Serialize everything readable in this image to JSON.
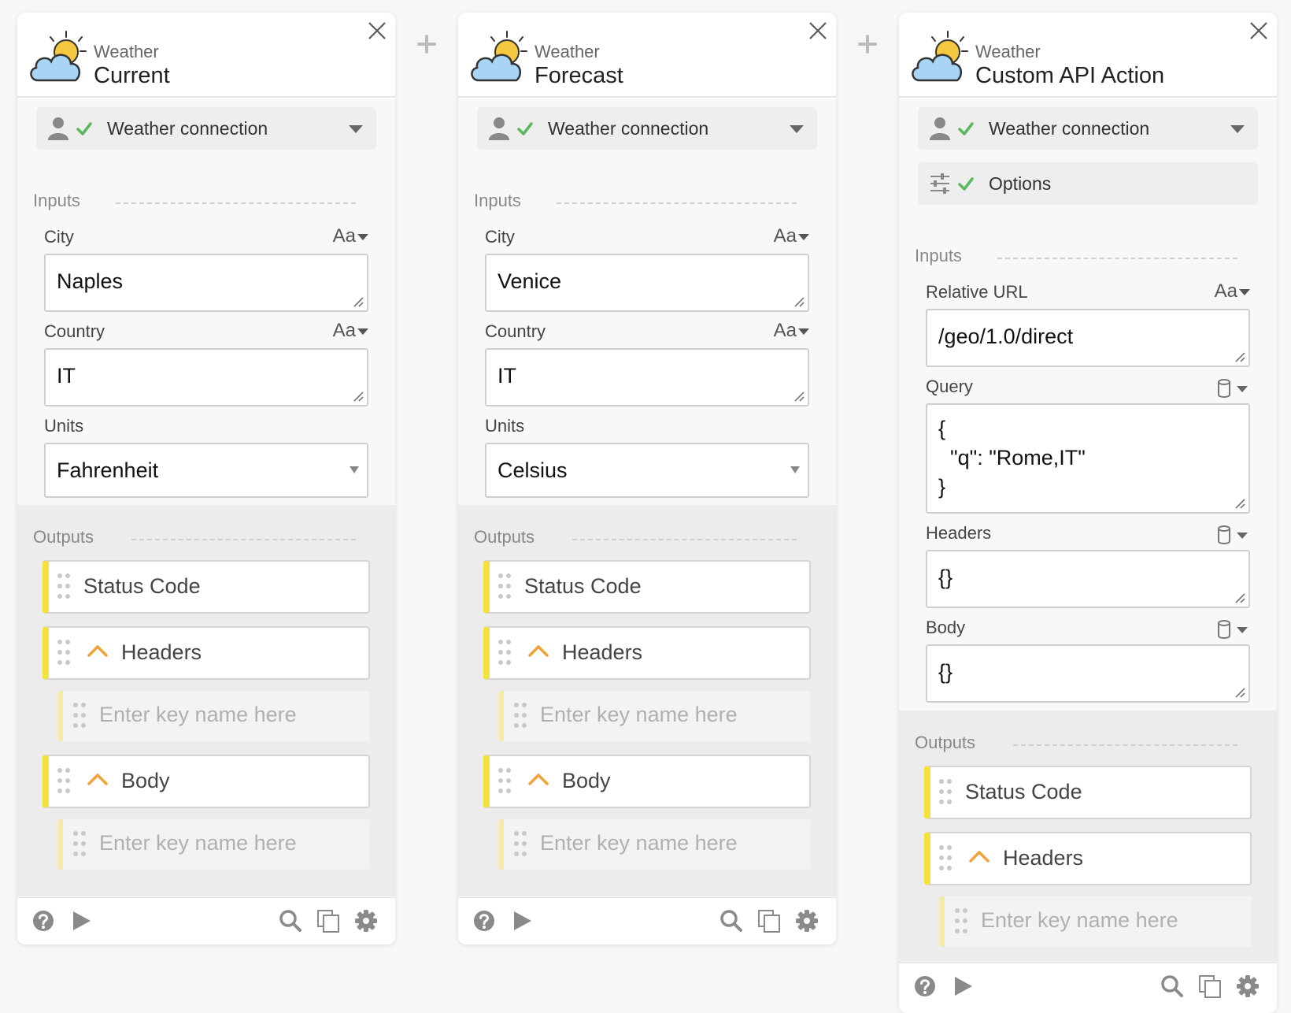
{
  "colors": {
    "accent_yellow": "#f3e23a",
    "check_green": "#5cb85c",
    "chevron_orange": "#f0a33a",
    "sun": "#f5c842",
    "cloud": "#a9d4f5"
  },
  "icons": {
    "logo": "weather-cloud-sun-icon",
    "close": "close-icon",
    "plus": "plus-icon",
    "user": "user-icon",
    "check": "check-icon",
    "options": "sliders-icon",
    "caret": "chevron-down-icon",
    "db": "database-icon",
    "drag": "drag-handle-icon",
    "expand": "chevron-up-icon",
    "help": "help-icon",
    "run": "play-icon",
    "search": "search-icon",
    "duplicate": "copy-icon",
    "settings": "gear-icon"
  },
  "cards": [
    {
      "app": "Weather",
      "action": "Current",
      "connection": "Weather connection",
      "inputs_title": "Inputs",
      "outputs_title": "Outputs",
      "type_label": "Aa",
      "fields": {
        "city_label": "City",
        "city_value": "Naples",
        "country_label": "Country",
        "country_value": "IT",
        "units_label": "Units",
        "units_value": "Fahrenheit"
      },
      "outputs": {
        "status": "Status Code",
        "headers": "Headers",
        "body": "Body",
        "key_placeholder": "Enter key name here"
      }
    },
    {
      "app": "Weather",
      "action": "Forecast",
      "connection": "Weather connection",
      "inputs_title": "Inputs",
      "outputs_title": "Outputs",
      "type_label": "Aa",
      "fields": {
        "city_label": "City",
        "city_value": "Venice",
        "country_label": "Country",
        "country_value": "IT",
        "units_label": "Units",
        "units_value": "Celsius"
      },
      "outputs": {
        "status": "Status Code",
        "headers": "Headers",
        "body": "Body",
        "key_placeholder": "Enter key name here"
      }
    },
    {
      "app": "Weather",
      "action": "Custom API Action",
      "connection": "Weather connection",
      "options": "Options",
      "inputs_title": "Inputs",
      "outputs_title": "Outputs",
      "type_label": "Aa",
      "fields": {
        "url_label": "Relative URL",
        "url_value": "/geo/1.0/direct",
        "query_label": "Query",
        "query_value": "{\n  \"q\": \"Rome,IT\"\n}",
        "headers_label": "Headers",
        "headers_value": "{}",
        "body_label": "Body",
        "body_value": "{}"
      },
      "outputs": {
        "status": "Status Code",
        "headers": "Headers",
        "key_placeholder": "Enter key name here"
      }
    }
  ]
}
